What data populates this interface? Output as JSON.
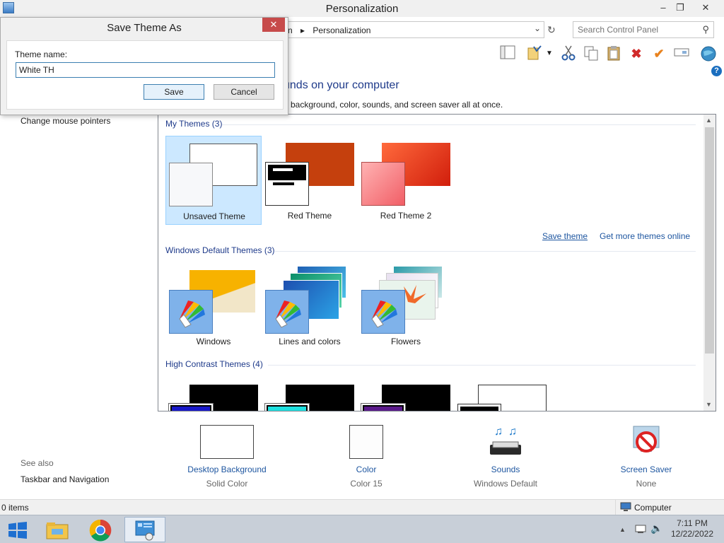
{
  "window": {
    "title": "Personalization",
    "minimize": "–",
    "restore": "❐",
    "close": "✕"
  },
  "address": {
    "crumb_prefix": "n",
    "crumb": "Personalization",
    "search_placeholder": "Search Control Panel"
  },
  "main": {
    "heading": "unds on your computer",
    "subheading": "p background, color, sounds, and screen saver all at once."
  },
  "sidebar": {
    "change_mouse": "Change mouse pointers",
    "see_also": "See also",
    "taskbar_nav": "Taskbar and Navigation"
  },
  "themes": {
    "my_themes": {
      "title": "My Themes (3)",
      "items": [
        {
          "label": "Unsaved Theme",
          "selected": true
        },
        {
          "label": "Red Theme",
          "selected": false
        },
        {
          "label": "Red Theme 2",
          "selected": false
        }
      ]
    },
    "save_theme": "Save theme",
    "get_more": "Get more themes online",
    "default_themes": {
      "title": "Windows Default Themes (3)",
      "items": [
        {
          "label": "Windows"
        },
        {
          "label": "Lines and colors"
        },
        {
          "label": "Flowers"
        }
      ]
    },
    "high_contrast": {
      "title": "High Contrast Themes (4)"
    }
  },
  "bottom": [
    {
      "name": "Desktop Background",
      "value": "Solid Color"
    },
    {
      "name": "Color",
      "value": "Color 15"
    },
    {
      "name": "Sounds",
      "value": "Windows Default"
    },
    {
      "name": "Screen Saver",
      "value": "None"
    }
  ],
  "status": {
    "items": "0 items",
    "computer": "Computer"
  },
  "taskbar": {
    "time": "7:11 PM",
    "date": "12/22/2022"
  },
  "dialog": {
    "title": "Save Theme As",
    "close": "✕",
    "field_label": "Theme name:",
    "field_value": "White TH",
    "save": "Save",
    "cancel": "Cancel"
  },
  "colors": {
    "link": "#1e56a0",
    "section": "#1e3a8a",
    "selection": "#cce8ff",
    "close_red": "#c74b4b"
  }
}
